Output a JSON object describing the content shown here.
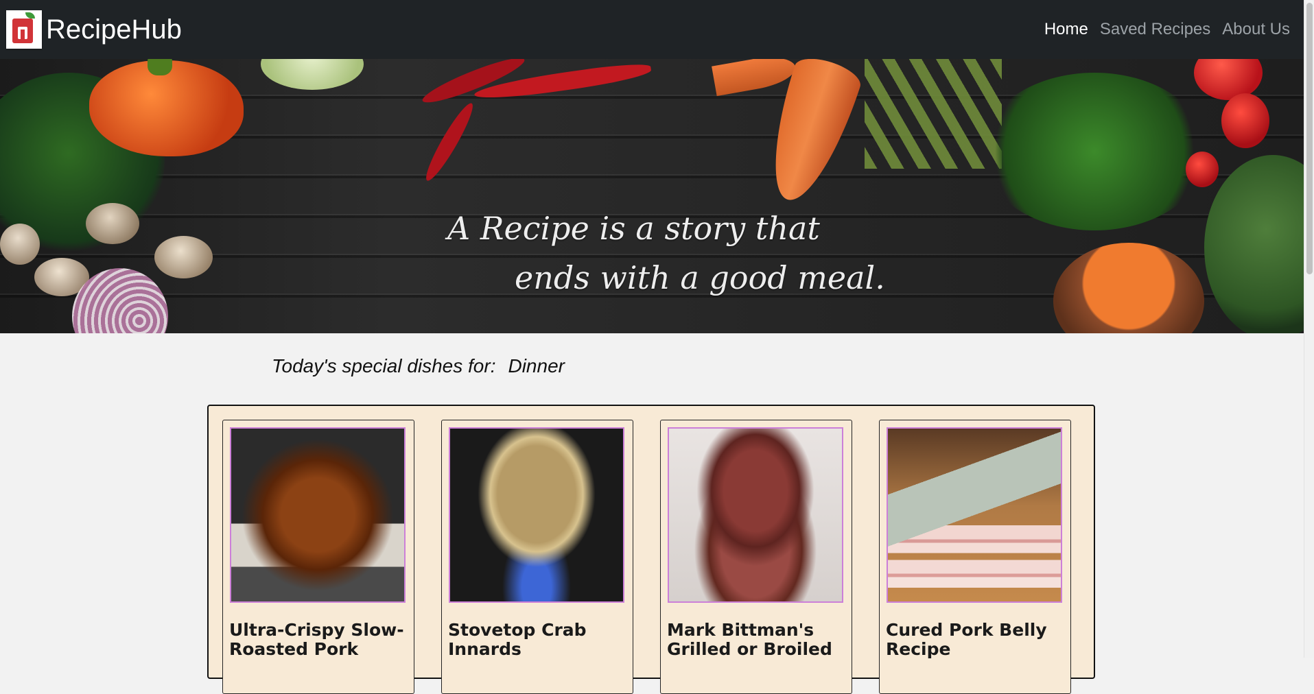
{
  "navbar": {
    "brand": "RecipeHub",
    "links": [
      {
        "label": "Home",
        "active": true
      },
      {
        "label": "Saved Recipes",
        "active": false
      },
      {
        "label": "About Us",
        "active": false
      }
    ]
  },
  "hero": {
    "quote_line1": "A Recipe is a story that",
    "quote_line2": "ends with a good meal."
  },
  "special": {
    "label": "Today's special dishes for:",
    "meal": "Dinner"
  },
  "recipes": [
    {
      "title": "Ultra-Crispy Slow-Roasted Pork"
    },
    {
      "title": "Stovetop Crab Innards"
    },
    {
      "title": "Mark Bittman's Grilled or Broiled"
    },
    {
      "title": "Cured Pork Belly Recipe"
    }
  ],
  "colors": {
    "navbar_bg": "#1f2326",
    "panel_bg": "#f8ead6",
    "image_border": "#cc7fd8",
    "active_link": "#ffffff",
    "inactive_link": "#9da3a8"
  }
}
